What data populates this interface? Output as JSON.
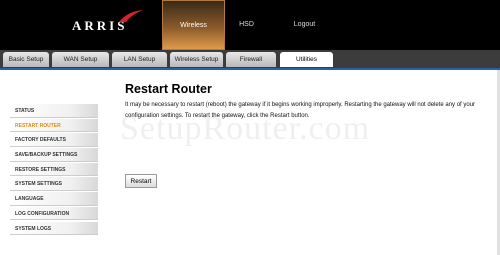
{
  "brand": {
    "logo_text": "ARRIS"
  },
  "top_tabs": [
    {
      "label": "Wireless",
      "active": true
    },
    {
      "label": "HSD",
      "active": false
    },
    {
      "label": "Logout",
      "active": false
    }
  ],
  "sub_tabs": [
    {
      "label": "Basic Setup",
      "active": false
    },
    {
      "label": "WAN Setup",
      "active": false
    },
    {
      "label": "LAN Setup",
      "active": false
    },
    {
      "label": "Wireless Setup",
      "active": false
    },
    {
      "label": "Firewall",
      "active": false
    },
    {
      "label": "Utilities",
      "active": true
    }
  ],
  "sidebar": {
    "items": [
      {
        "label": "STATUS",
        "active": false
      },
      {
        "label": "RESTART ROUTER",
        "active": true
      },
      {
        "label": "FACTORY DEFAULTS",
        "active": false
      },
      {
        "label": "SAVE/BACKUP SETTINGS",
        "active": false
      },
      {
        "label": "RESTORE SETTINGS",
        "active": false
      },
      {
        "label": "SYSTEM SETTINGS",
        "active": false
      },
      {
        "label": "LANGUAGE",
        "active": false
      },
      {
        "label": "LOG CONFIGURATION",
        "active": false
      },
      {
        "label": "SYSTEM LOGS",
        "active": false
      }
    ]
  },
  "main": {
    "title": "Restart Router",
    "description": "It may be necessary to restart (reboot) the gateway if it begins working improperly. Restarting the gateway will not delete any of your configuration settings. To restart the gateway, click the Restart button.",
    "restart_button": "Restart"
  },
  "watermark": "SetupRouter.com",
  "colors": {
    "accent": "#e08a1a",
    "tab_bar": "#3c3c3c",
    "blue_bar": "#2b60a8"
  }
}
